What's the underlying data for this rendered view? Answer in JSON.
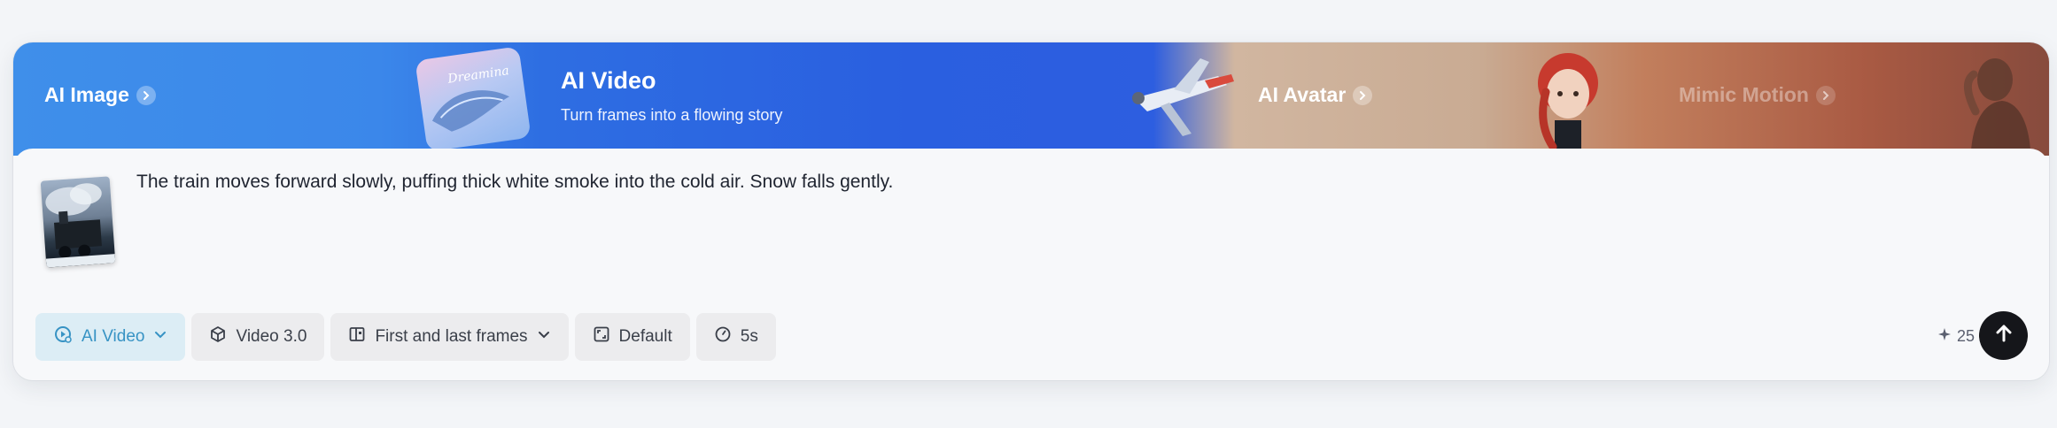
{
  "banner": {
    "tab_ai_image": "AI Image",
    "active_tab_title": "AI Video",
    "active_tab_subtitle": "Turn frames into a flowing story",
    "tab_ai_avatar": "AI Avatar",
    "tab_mimic_motion": "Mimic Motion",
    "thumbnail_text": "Dreamina"
  },
  "composer": {
    "prompt_text": "The train moves forward slowly, puffing thick white smoke into the cold air. Snow falls gently.",
    "toolbar": {
      "mode": "AI Video",
      "model": "Video 3.0",
      "frames": "First and last frames",
      "aspect": "Default",
      "duration": "5s"
    },
    "credits": "25"
  },
  "colors": {
    "banner_blue": "#2a5fe0",
    "active_chip_bg": "#dcedf5",
    "active_chip_text": "#3793c4",
    "send_button": "#15161a"
  },
  "icons": {
    "tab_chevron": "chevron-right-icon",
    "mode": "video-spark-icon",
    "model": "cube-icon",
    "frames": "frames-icon",
    "aspect": "aspect-ratio-icon",
    "duration": "clock-icon",
    "credit": "sparkle-icon",
    "send": "arrow-up-icon"
  }
}
